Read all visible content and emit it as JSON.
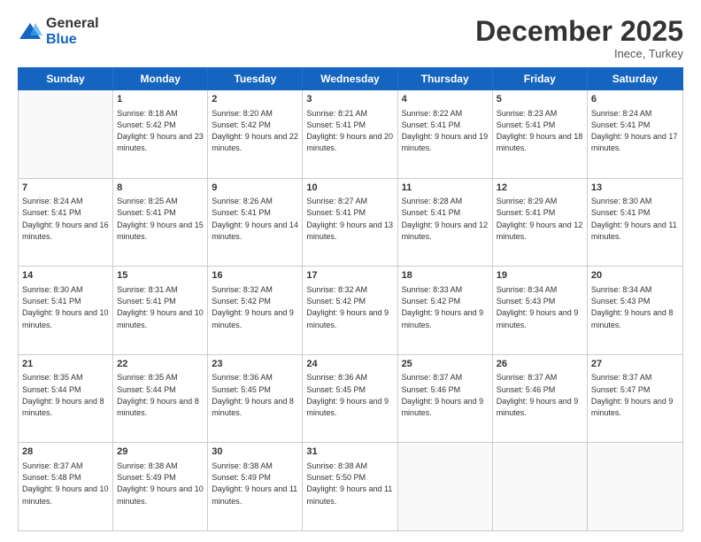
{
  "logo": {
    "general": "General",
    "blue": "Blue"
  },
  "title": "December 2025",
  "location": "Inece, Turkey",
  "days": [
    "Sunday",
    "Monday",
    "Tuesday",
    "Wednesday",
    "Thursday",
    "Friday",
    "Saturday"
  ],
  "weeks": [
    [
      {
        "day": "",
        "empty": true
      },
      {
        "day": "1",
        "sunrise": "8:18 AM",
        "sunset": "5:42 PM",
        "daylight": "9 hours and 23 minutes."
      },
      {
        "day": "2",
        "sunrise": "8:20 AM",
        "sunset": "5:42 PM",
        "daylight": "9 hours and 22 minutes."
      },
      {
        "day": "3",
        "sunrise": "8:21 AM",
        "sunset": "5:41 PM",
        "daylight": "9 hours and 20 minutes."
      },
      {
        "day": "4",
        "sunrise": "8:22 AM",
        "sunset": "5:41 PM",
        "daylight": "9 hours and 19 minutes."
      },
      {
        "day": "5",
        "sunrise": "8:23 AM",
        "sunset": "5:41 PM",
        "daylight": "9 hours and 18 minutes."
      },
      {
        "day": "6",
        "sunrise": "8:24 AM",
        "sunset": "5:41 PM",
        "daylight": "9 hours and 17 minutes."
      }
    ],
    [
      {
        "day": "7",
        "sunrise": "8:24 AM",
        "sunset": "5:41 PM",
        "daylight": "9 hours and 16 minutes."
      },
      {
        "day": "8",
        "sunrise": "8:25 AM",
        "sunset": "5:41 PM",
        "daylight": "9 hours and 15 minutes."
      },
      {
        "day": "9",
        "sunrise": "8:26 AM",
        "sunset": "5:41 PM",
        "daylight": "9 hours and 14 minutes."
      },
      {
        "day": "10",
        "sunrise": "8:27 AM",
        "sunset": "5:41 PM",
        "daylight": "9 hours and 13 minutes."
      },
      {
        "day": "11",
        "sunrise": "8:28 AM",
        "sunset": "5:41 PM",
        "daylight": "9 hours and 12 minutes."
      },
      {
        "day": "12",
        "sunrise": "8:29 AM",
        "sunset": "5:41 PM",
        "daylight": "9 hours and 12 minutes."
      },
      {
        "day": "13",
        "sunrise": "8:30 AM",
        "sunset": "5:41 PM",
        "daylight": "9 hours and 11 minutes."
      }
    ],
    [
      {
        "day": "14",
        "sunrise": "8:30 AM",
        "sunset": "5:41 PM",
        "daylight": "9 hours and 10 minutes."
      },
      {
        "day": "15",
        "sunrise": "8:31 AM",
        "sunset": "5:41 PM",
        "daylight": "9 hours and 10 minutes."
      },
      {
        "day": "16",
        "sunrise": "8:32 AM",
        "sunset": "5:42 PM",
        "daylight": "9 hours and 9 minutes."
      },
      {
        "day": "17",
        "sunrise": "8:32 AM",
        "sunset": "5:42 PM",
        "daylight": "9 hours and 9 minutes."
      },
      {
        "day": "18",
        "sunrise": "8:33 AM",
        "sunset": "5:42 PM",
        "daylight": "9 hours and 9 minutes."
      },
      {
        "day": "19",
        "sunrise": "8:34 AM",
        "sunset": "5:43 PM",
        "daylight": "9 hours and 9 minutes."
      },
      {
        "day": "20",
        "sunrise": "8:34 AM",
        "sunset": "5:43 PM",
        "daylight": "9 hours and 8 minutes."
      }
    ],
    [
      {
        "day": "21",
        "sunrise": "8:35 AM",
        "sunset": "5:44 PM",
        "daylight": "9 hours and 8 minutes."
      },
      {
        "day": "22",
        "sunrise": "8:35 AM",
        "sunset": "5:44 PM",
        "daylight": "9 hours and 8 minutes."
      },
      {
        "day": "23",
        "sunrise": "8:36 AM",
        "sunset": "5:45 PM",
        "daylight": "9 hours and 8 minutes."
      },
      {
        "day": "24",
        "sunrise": "8:36 AM",
        "sunset": "5:45 PM",
        "daylight": "9 hours and 9 minutes."
      },
      {
        "day": "25",
        "sunrise": "8:37 AM",
        "sunset": "5:46 PM",
        "daylight": "9 hours and 9 minutes."
      },
      {
        "day": "26",
        "sunrise": "8:37 AM",
        "sunset": "5:46 PM",
        "daylight": "9 hours and 9 minutes."
      },
      {
        "day": "27",
        "sunrise": "8:37 AM",
        "sunset": "5:47 PM",
        "daylight": "9 hours and 9 minutes."
      }
    ],
    [
      {
        "day": "28",
        "sunrise": "8:37 AM",
        "sunset": "5:48 PM",
        "daylight": "9 hours and 10 minutes."
      },
      {
        "day": "29",
        "sunrise": "8:38 AM",
        "sunset": "5:49 PM",
        "daylight": "9 hours and 10 minutes."
      },
      {
        "day": "30",
        "sunrise": "8:38 AM",
        "sunset": "5:49 PM",
        "daylight": "9 hours and 11 minutes."
      },
      {
        "day": "31",
        "sunrise": "8:38 AM",
        "sunset": "5:50 PM",
        "daylight": "9 hours and 11 minutes."
      },
      {
        "day": "",
        "empty": true
      },
      {
        "day": "",
        "empty": true
      },
      {
        "day": "",
        "empty": true
      }
    ]
  ]
}
